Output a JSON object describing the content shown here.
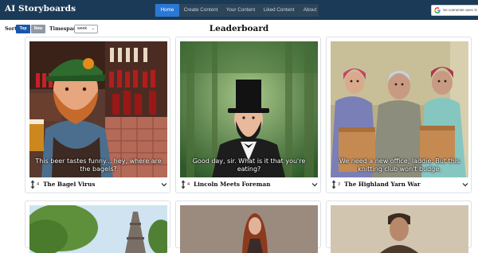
{
  "navbar": {
    "brand": "AI Storyboards",
    "links": [
      {
        "label": "Home",
        "active": true
      },
      {
        "label": "Create Content",
        "active": false
      },
      {
        "label": "Your Content",
        "active": false
      },
      {
        "label": "Liked Content",
        "active": false
      },
      {
        "label": "About",
        "active": false
      }
    ],
    "google_signin": "Se connecter avec G"
  },
  "sort": {
    "label": "Sort:",
    "options": [
      "Top",
      "New"
    ],
    "selected": "Top",
    "timespan_label": "Timespan:",
    "timespan_value": "week"
  },
  "page_title": "Leaderboard",
  "cards": [
    {
      "title": "The Bagel Virus",
      "votes": "4",
      "caption": "This beer tastes funny... hey, where are the bagels?"
    },
    {
      "title": "Lincoln Meets Foreman",
      "votes": "4",
      "caption": "Good day, sir. What is it that you're eating?"
    },
    {
      "title": "The Highland Yarn War",
      "votes": "3",
      "caption": "We need a new office, laddie. But this knitting club won't budge."
    }
  ],
  "colors": {
    "navbar": "#1b3a57",
    "active_nav": "#2a78d6",
    "top_button": "#1a56a8",
    "new_button": "#8f9aa6"
  },
  "icons": {
    "vote": "updown-arrow-icon",
    "expand": "chevron-down-icon",
    "google": "google-g-icon"
  }
}
